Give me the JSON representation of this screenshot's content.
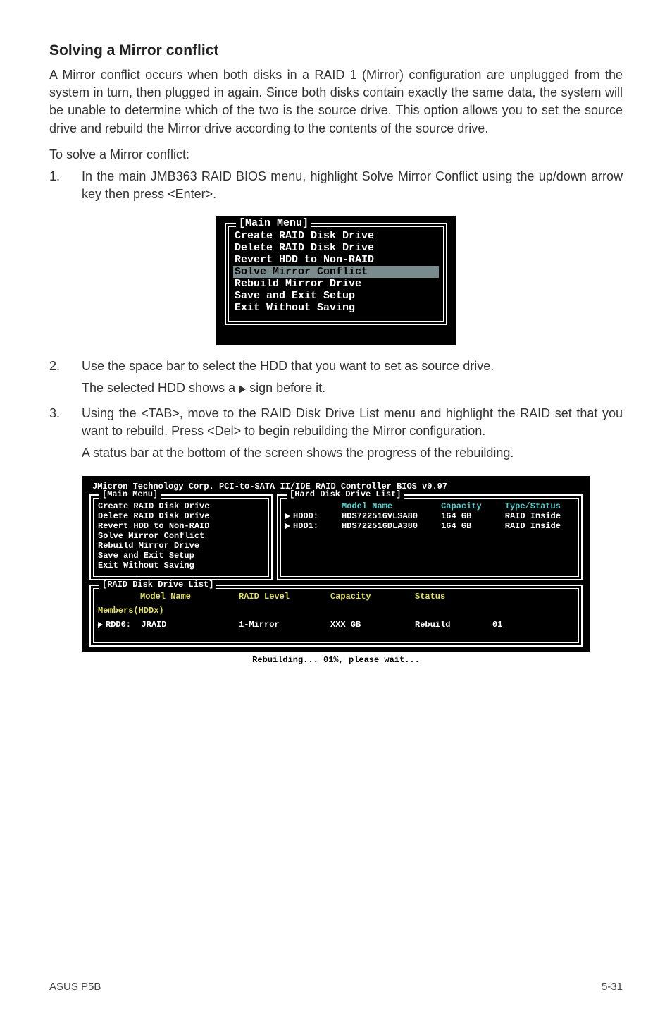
{
  "heading": "Solving a Mirror conflict",
  "para_intro": "A Mirror conflict occurs when both disks in a RAID 1 (Mirror) configuration are unplugged from the system in turn, then plugged in again. Since both disks contain exactly the same data, the system will be unable to determine which of the two is the source drive. This option allows you to set the source drive and rebuild the Mirror drive according to the contents of the source drive.",
  "para_lead": "To solve a Mirror conflict:",
  "steps": {
    "s1_num": "1.",
    "s1_txt": "In the main JMB363 RAID BIOS menu, highlight Solve Mirror Conflict using the up/down arrow key then press <Enter>.",
    "s2_num": "2.",
    "s2_txt": "Use the space bar to select the HDD that you want to set as source drive.",
    "s2_sub_a": "The selected HDD shows a ",
    "s2_sub_b": " sign before it.",
    "s3_num": "3.",
    "s3_txt": "Using the <TAB>, move to the RAID Disk Drive List menu and highlight the RAID set that you want to rebuild. Press <Del> to begin rebuilding the Mirror configuration.",
    "s3_sub": "A status bar at the bottom of the screen shows the progress of the rebuilding."
  },
  "bios1": {
    "legend": "[Main Menu]",
    "items": [
      "Create RAID Disk Drive",
      "Delete RAID Disk Drive",
      "Revert HDD to Non-RAID",
      "Solve Mirror Conflict",
      "Rebuild Mirror Drive",
      "Save and Exit Setup",
      "Exit Without Saving"
    ],
    "highlight_index": 3
  },
  "bios2": {
    "title": "JMicron Technology Corp. PCI-to-SATA II/IDE RAID Controller BIOS v0.97",
    "main_legend": "[Main Menu]",
    "main_items": [
      "Create RAID Disk Drive",
      "Delete RAID Disk Drive",
      "Revert HDD to Non-RAID",
      "Solve Mirror Conflict",
      "Rebuild Mirror Drive",
      "Save and Exit Setup",
      "Exit Without Saving"
    ],
    "hdd_legend": "[Hard Disk Drive List]",
    "hdd_headers": {
      "c1": "Model Name",
      "c2": "Capacity",
      "c3": "Type/Status"
    },
    "hdd_rows": [
      {
        "label": "HDD0:",
        "model": "HDS722516VLSA80",
        "cap": "164 GB",
        "status": "RAID Inside"
      },
      {
        "label": "HDD1:",
        "model": "HDS722516DLA380",
        "cap": "164 GB",
        "status": "RAID Inside"
      }
    ],
    "raid_legend": "[RAID Disk Drive List]",
    "raid_headers": {
      "c1": "Model Name",
      "c2": "RAID Level",
      "c3": "Capacity",
      "c4": "Status"
    },
    "raid_members_label": "Members(HDDx)",
    "raid_row": {
      "label": "RDD0:",
      "name": "JRAID",
      "level": "1-Mirror",
      "cap": "XXX GB",
      "status": "Rebuild",
      "members": "01"
    },
    "statusbar": "Rebuilding... 01%, please wait..."
  },
  "footer": {
    "left": "ASUS P5B",
    "right": "5-31"
  }
}
